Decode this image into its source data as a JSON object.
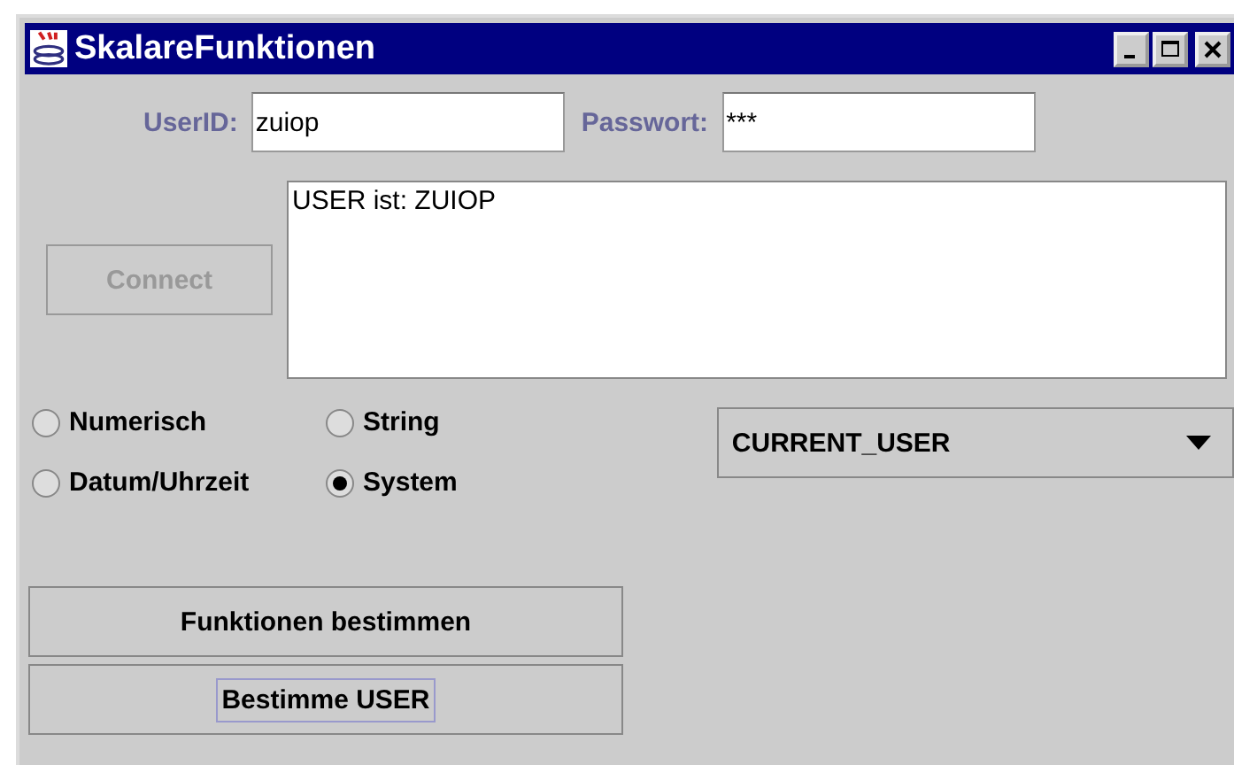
{
  "window": {
    "title": "SkalareFunktionen"
  },
  "login": {
    "user_label": "UserID:",
    "user_value": "zuiop",
    "password_label": "Passwort:",
    "password_value": "***"
  },
  "connect_button": {
    "label": "Connect",
    "disabled": true
  },
  "output": {
    "value": "USER ist: ZUIOP"
  },
  "radios": [
    {
      "label": "Numerisch",
      "selected": false
    },
    {
      "label": "String",
      "selected": false
    },
    {
      "label": "Datum/Uhrzeit",
      "selected": false
    },
    {
      "label": "System",
      "selected": true
    }
  ],
  "function_dropdown": {
    "value": "CURRENT_USER"
  },
  "buttons": [
    {
      "label": "Funktionen bestimmen",
      "focused": false
    },
    {
      "label": "Bestimme USER",
      "focused": true
    }
  ]
}
